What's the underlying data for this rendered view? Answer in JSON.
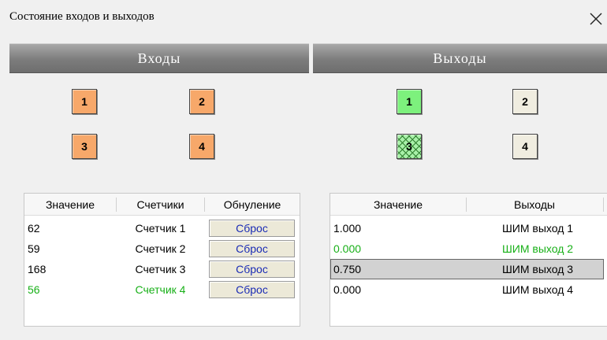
{
  "window": {
    "title": "Состояние входов и выходов"
  },
  "inputs": {
    "header": "Входы",
    "indicators": [
      {
        "label": "1",
        "state": "orange"
      },
      {
        "label": "2",
        "state": "orange"
      },
      {
        "label": "3",
        "state": "orange"
      },
      {
        "label": "4",
        "state": "orange"
      }
    ],
    "table": {
      "columns": [
        "Значение",
        "Счетчики",
        "Обнуление"
      ],
      "rows": [
        {
          "value": "62",
          "counter": "Счетчик 1",
          "reset": "Сброс",
          "highlight": false
        },
        {
          "value": "59",
          "counter": "Счетчик 2",
          "reset": "Сброс",
          "highlight": false
        },
        {
          "value": "168",
          "counter": "Счетчик 3",
          "reset": "Сброс",
          "highlight": false
        },
        {
          "value": "56",
          "counter": "Счетчик 4",
          "reset": "Сброс",
          "highlight": true
        }
      ]
    }
  },
  "outputs": {
    "header": "Выходы",
    "indicators": [
      {
        "label": "1",
        "state": "green"
      },
      {
        "label": "2",
        "state": "off"
      },
      {
        "label": "3",
        "state": "hatched"
      },
      {
        "label": "4",
        "state": "off"
      }
    ],
    "table": {
      "columns": [
        "Значение",
        "Выходы"
      ],
      "rows": [
        {
          "value": "1.000",
          "output": "ШИМ выход 1",
          "highlight": false,
          "selected": false
        },
        {
          "value": "0.000",
          "output": "ШИМ выход 2",
          "highlight": true,
          "selected": false
        },
        {
          "value": "0.750",
          "output": "ШИМ выход 3",
          "highlight": false,
          "selected": true
        },
        {
          "value": "0.000",
          "output": "ШИМ выход 4",
          "highlight": false,
          "selected": false
        }
      ]
    }
  },
  "colors": {
    "input_active": "#f7a86a",
    "output_active": "#7df17d",
    "output_off": "#f0ede0",
    "highlight_text": "#18b018",
    "reset_text": "#1a2bb5"
  }
}
